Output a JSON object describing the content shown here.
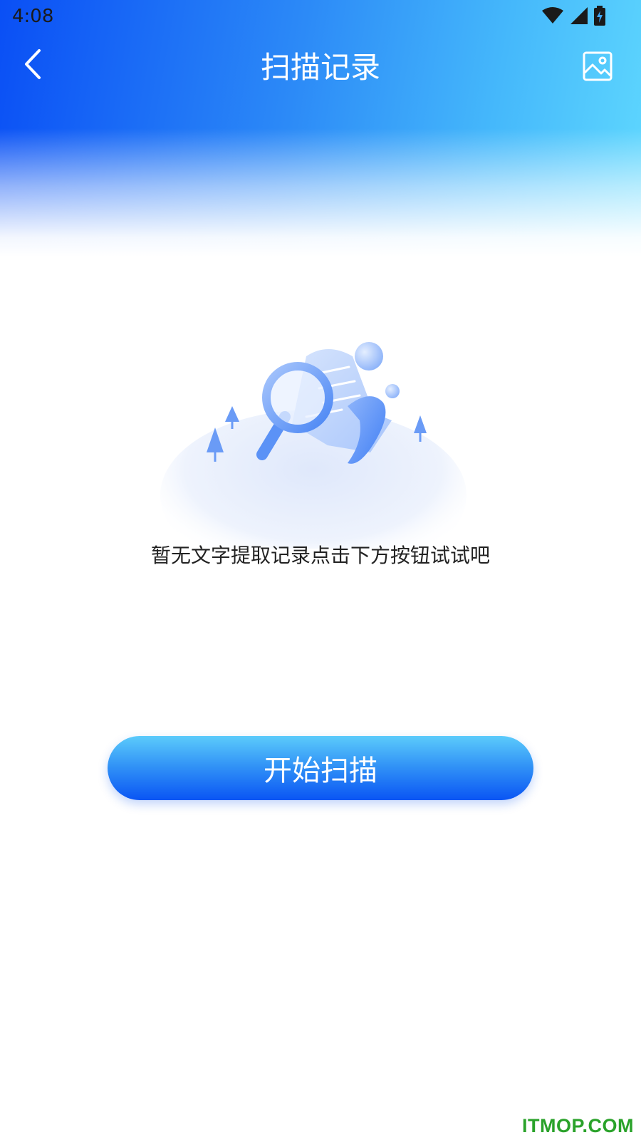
{
  "status_bar": {
    "time": "4:08",
    "icons": [
      "wifi-icon",
      "signal-icon",
      "battery-charging-icon"
    ]
  },
  "nav": {
    "title": "扫描记录",
    "back_icon": "chevron-left-icon",
    "right_icon": "image-gallery-icon"
  },
  "empty_state": {
    "illustration": "magnifier-over-document-illustration",
    "message": "暂无文字提取记录点击下方按钮试试吧"
  },
  "start_button": {
    "label": "开始扫描"
  },
  "watermark": {
    "text": "ITMOP.COM"
  },
  "colors": {
    "header_start": "#0a4ff5",
    "header_end": "#5fd8fe",
    "button_top": "#5ccbfb",
    "button_bottom": "#0a55f4",
    "watermark": "#2aa22a"
  }
}
